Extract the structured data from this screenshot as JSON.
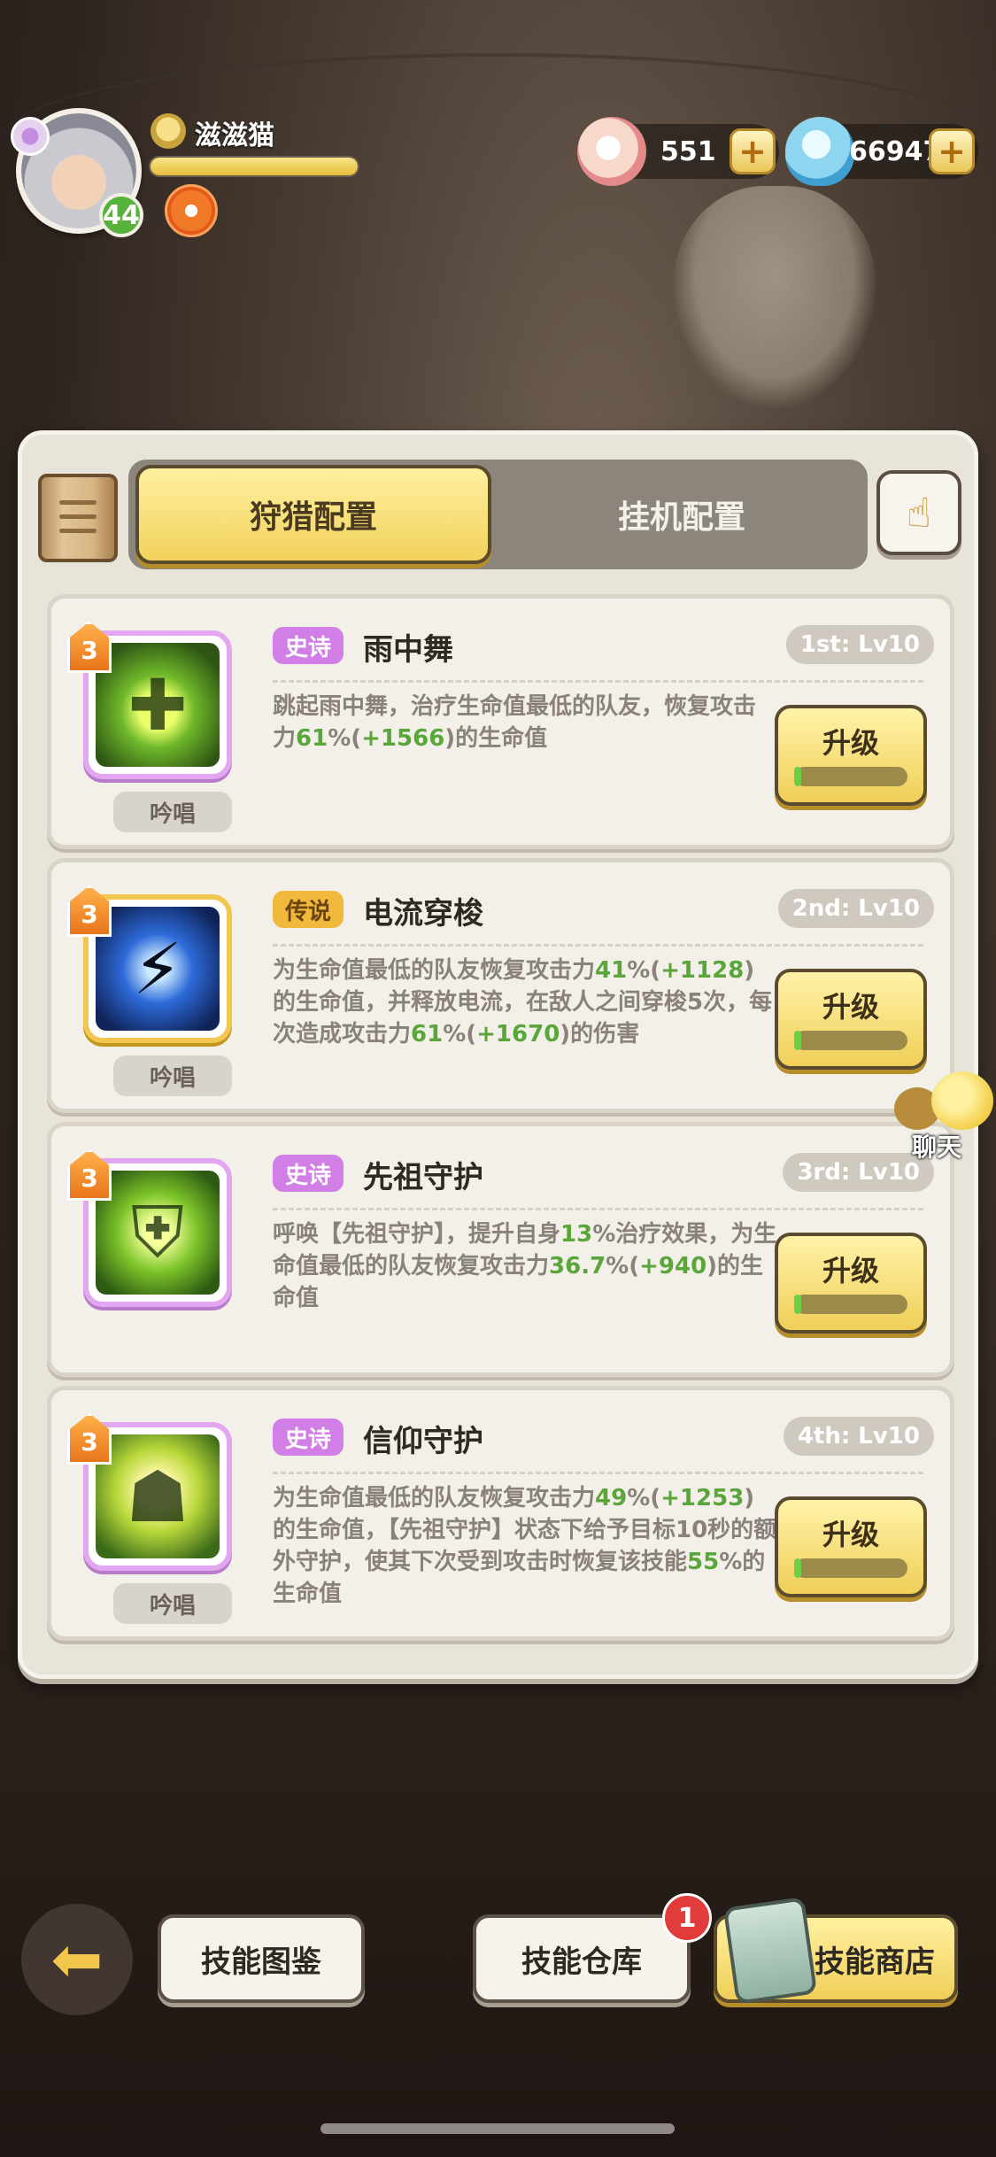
{
  "player": {
    "name": "滋滋猫",
    "level": "44",
    "xp_fraction": 1.0
  },
  "currency": {
    "pearls": "551",
    "gems": "66947"
  },
  "tabs": {
    "hunt": "狩猎配置",
    "idle": "挂机配置"
  },
  "skills": [
    {
      "stars": "3",
      "rarity": "史诗",
      "name": "雨中舞",
      "slot": "1st: Lv10",
      "desc_parts": [
        "跳起雨中舞，治疗生命值最低的队友，恢复攻击力",
        "61",
        "%(",
        "+1566",
        ")的生命值"
      ],
      "chant": "吟唱",
      "upgrade": "升级",
      "icon": "rain-dance-icon"
    },
    {
      "stars": "3",
      "rarity": "传说",
      "name": "电流穿梭",
      "slot": "2nd: Lv10",
      "desc_parts": [
        "为生命值最低的队友恢复攻击力",
        "41",
        "%(",
        "+1128",
        ")的生命值，并释放电流，在敌人之间穿梭5次，每次造成攻击力",
        "61",
        "%(",
        "+1670",
        ")的伤害"
      ],
      "chant": "吟唱",
      "upgrade": "升级",
      "icon": "lightning-shuttle-icon"
    },
    {
      "stars": "3",
      "rarity": "史诗",
      "name": "先祖守护",
      "slot": "3rd: Lv10",
      "desc_parts": [
        "呼唤【先祖守护】，提升自身",
        "13",
        "%治疗效果，为生命值最低的队友恢复攻击力",
        "36.7",
        "%(",
        "+940",
        ")的生命值"
      ],
      "chant": "",
      "upgrade": "升级",
      "icon": "ancestor-guard-icon"
    },
    {
      "stars": "3",
      "rarity": "史诗",
      "name": "信仰守护",
      "slot": "4th: Lv10",
      "desc_parts": [
        "为生命值最低的队友恢复攻击力",
        "49",
        "%(",
        "+1253",
        ")的生命值，【先祖守护】状态下给予目标10秒的额外守护，使其下次受到攻击时恢复该技能",
        "55",
        "%的生命值"
      ],
      "chant": "吟唱",
      "upgrade": "升级",
      "icon": "faith-guard-icon"
    }
  ],
  "chat": {
    "label": "聊天"
  },
  "bottom": {
    "codex": "技能图鉴",
    "storage": "技能仓库",
    "storage_badge": "1",
    "shop": "技能商店"
  },
  "colors": {
    "accent_yellow": "#f0cf58",
    "epic_purple": "#d17ee6",
    "legend_gold": "#f1b93b",
    "value_green": "#5aa63a"
  }
}
